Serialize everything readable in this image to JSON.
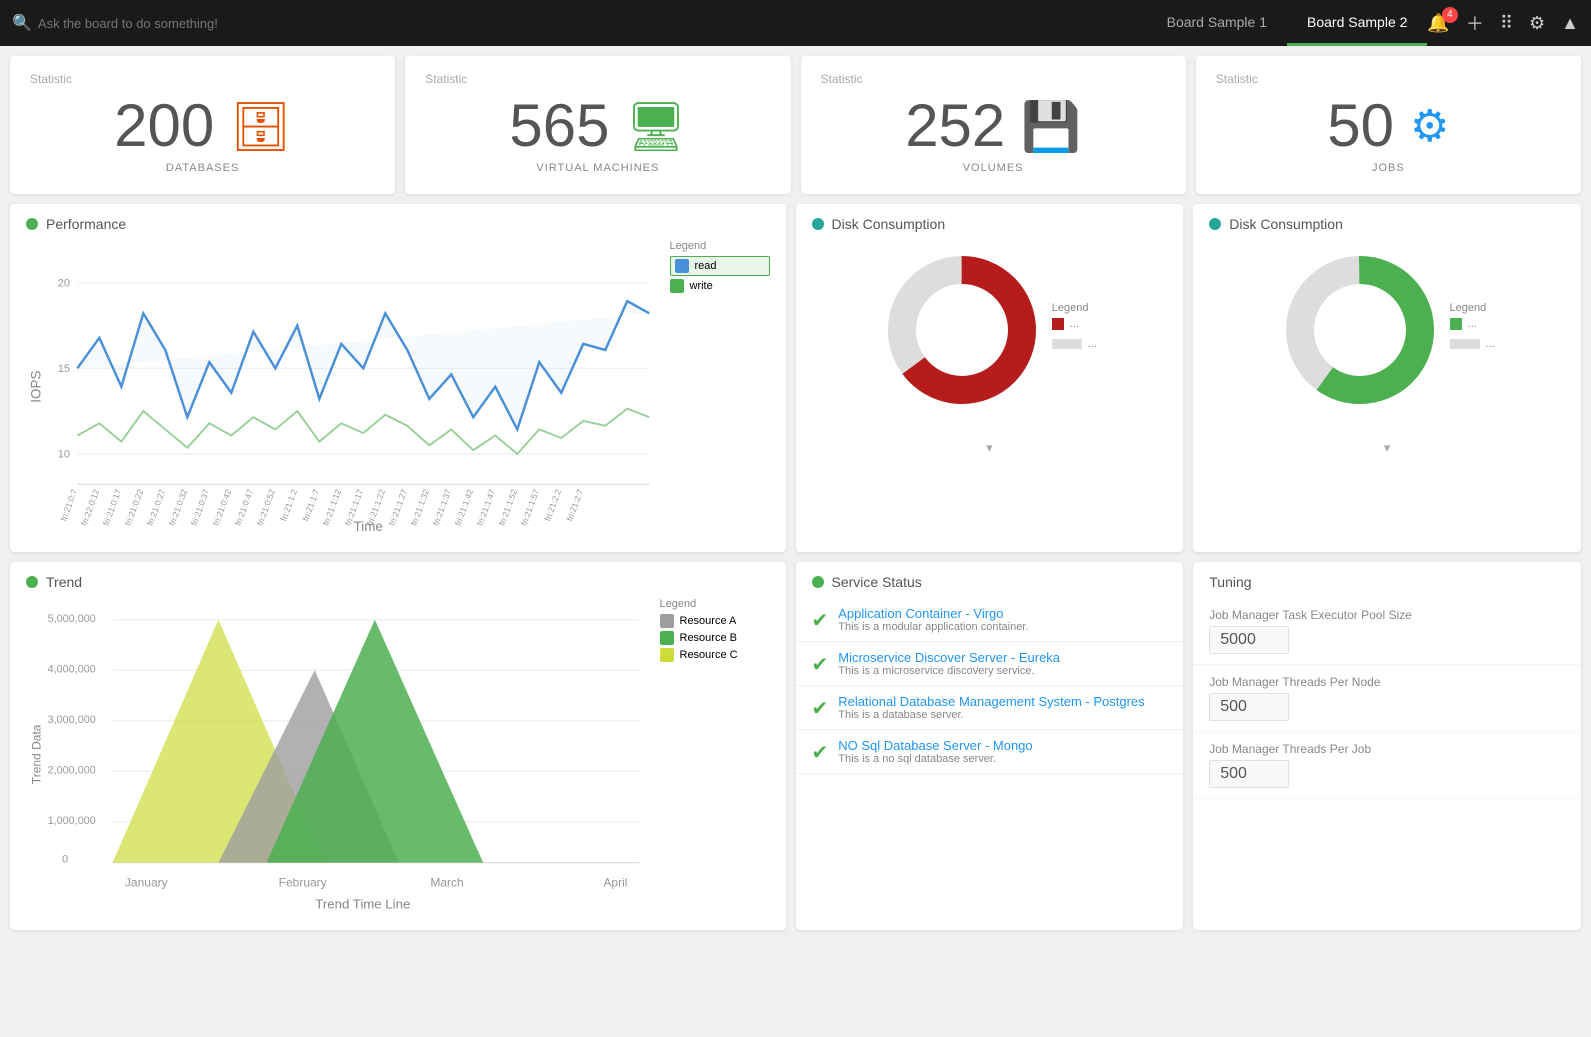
{
  "topnav": {
    "search_placeholder": "Ask the board to do something!",
    "tabs": [
      {
        "label": "Board Sample 1",
        "active": false
      },
      {
        "label": "Board Sample 2",
        "active": true
      }
    ],
    "notif_count": "4"
  },
  "stats": [
    {
      "label": "Statistic",
      "num": "200",
      "sub": "DATABASES",
      "icon": "🗄",
      "icon_color": "#e65100"
    },
    {
      "label": "Statistic",
      "num": "565",
      "sub": "VIRTUAL MACHINES",
      "icon": "🖥",
      "icon_color": "#4caf50"
    },
    {
      "label": "Statistic",
      "num": "252",
      "sub": "VOLUMES",
      "icon": "💾",
      "icon_color": "#9c27b0"
    },
    {
      "label": "Statistic",
      "num": "50",
      "sub": "JOBS",
      "icon": "⚙",
      "icon_color": "#2196f3"
    }
  ],
  "performance": {
    "title": "Performance",
    "y_axis_label": "IOPS",
    "x_axis_label": "Time",
    "legend_title": "Legend",
    "legend_items": [
      {
        "label": "read",
        "color": "#4a90d9",
        "selected": true
      },
      {
        "label": "write",
        "color": "#4caf50",
        "selected": false
      }
    ],
    "y_ticks": [
      "20",
      "15",
      "10"
    ],
    "x_ticks": [
      "fri:21:0:7",
      "fri:22:0:12",
      "fri:21:0:17",
      "fri:21:0:22",
      "fri:21:0:27",
      "fri:21:0:32",
      "fri:21:0:37",
      "fri:21:0:42",
      "fri:21:0:47",
      "fri:21:0:52",
      "fri:21:1:2",
      "fri:21:1:7",
      "fri:21:1:12",
      "fri:21:1:17",
      "fri:21:1:22",
      "fri:21:1:27",
      "fri:21:1:32",
      "fri:21:1:37",
      "fri:21:1:42",
      "fri:21:1:47",
      "fri:21:1:52",
      "fri:21:1:57",
      "fri:21:2:2",
      "fri:21:2:7"
    ]
  },
  "disk_consumption_1": {
    "title": "Disk Consumption",
    "legend_title": "Legend",
    "red_pct": 65,
    "gray_pct": 35,
    "legend_items": [
      {
        "color": "#b71c1c",
        "label": "..."
      },
      {
        "color": "#ddd",
        "label": "..."
      }
    ]
  },
  "disk_consumption_2": {
    "title": "Disk Consumption",
    "legend_title": "Legend",
    "green_pct": 60,
    "gray_pct": 40,
    "legend_items": [
      {
        "color": "#4caf50",
        "label": "..."
      },
      {
        "color": "#ddd",
        "label": "..."
      }
    ]
  },
  "trend": {
    "title": "Trend",
    "y_axis_label": "Trend Data",
    "x_axis_label": "Trend Time Line",
    "legend_title": "Legend",
    "legend_items": [
      {
        "label": "Resource A",
        "color": "#9e9e9e"
      },
      {
        "label": "Resource B",
        "color": "#4caf50"
      },
      {
        "label": "Resource C",
        "color": "#cddc39"
      }
    ],
    "x_ticks": [
      "January",
      "February",
      "March",
      "April"
    ],
    "y_ticks": [
      "5,000,000",
      "4,000,000",
      "3,000,000",
      "2,000,000",
      "1,000,000",
      "0"
    ]
  },
  "service_status": {
    "title": "Service Status",
    "items": [
      {
        "name": "Application Container - Virgo",
        "desc": "This is a modular application container."
      },
      {
        "name": "Microservice Discover Server - Eureka",
        "desc": "This is a microservice discovery service."
      },
      {
        "name": "Relational Database Management System - Postgres",
        "desc": "This is a database server."
      },
      {
        "name": "NO Sql Database Server - Mongo",
        "desc": "This is a no sql database server."
      }
    ]
  },
  "tuning": {
    "title": "Tuning",
    "items": [
      {
        "label": "Job Manager Task Executor Pool Size",
        "value": "5000"
      },
      {
        "label": "Job Manager Threads Per Node",
        "value": "500"
      },
      {
        "label": "Job Manager Threads Per Job",
        "value": "500"
      }
    ]
  }
}
